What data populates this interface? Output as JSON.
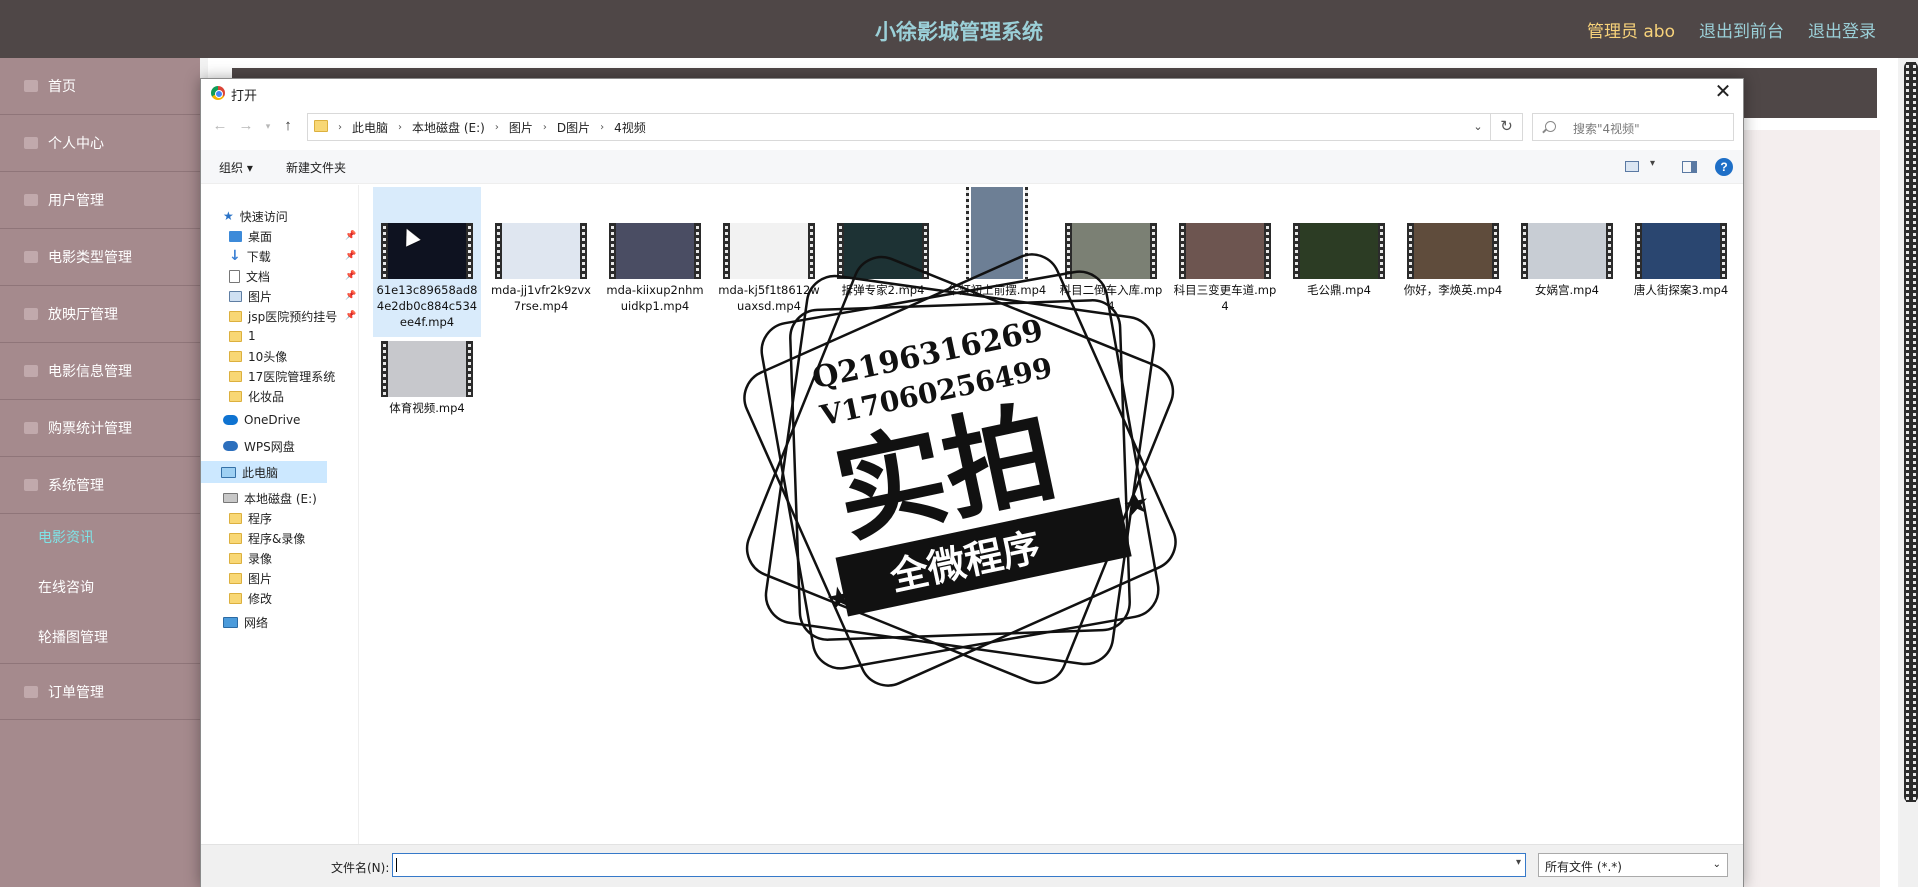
{
  "app": {
    "title": "小徐影城管理系统",
    "nav": [
      {
        "label": "管理员 abo",
        "color": "#f7d27a"
      },
      {
        "label": "退出到前台",
        "color": "#9bd0d8"
      },
      {
        "label": "退出登录",
        "color": "#9bd0d8"
      }
    ]
  },
  "sidebar": {
    "items": [
      {
        "label": "首页"
      },
      {
        "label": "个人中心"
      },
      {
        "label": "用户管理"
      },
      {
        "label": "电影类型管理"
      },
      {
        "label": "放映厅管理"
      },
      {
        "label": "电影信息管理"
      },
      {
        "label": "购票统计管理"
      },
      {
        "label": "系统管理"
      }
    ],
    "sub_items": [
      {
        "label": "电影资讯",
        "active": true
      },
      {
        "label": "在线咨询",
        "active": false
      },
      {
        "label": "轮播图管理",
        "active": false
      }
    ],
    "last_item": {
      "label": "订单管理"
    }
  },
  "dialog": {
    "title": "打开",
    "breadcrumbs": [
      "此电脑",
      "本地磁盘 (E:)",
      "图片",
      "D图片",
      "4视频"
    ],
    "search_placeholder": "搜索\"4视频\"",
    "toolbar": {
      "organize": "组织 ▾",
      "new_folder": "新建文件夹"
    },
    "nav_pane": [
      {
        "label": "快速访问",
        "icon": "star"
      },
      {
        "label": "桌面",
        "icon": "desk",
        "pinned": true
      },
      {
        "label": "下载",
        "icon": "dl",
        "pinned": true
      },
      {
        "label": "文档",
        "icon": "doc",
        "pinned": true
      },
      {
        "label": "图片",
        "icon": "pic",
        "pinned": true
      },
      {
        "label": "jsp医院预约挂号",
        "icon": "folder",
        "pinned": true
      },
      {
        "label": "1",
        "icon": "folder"
      },
      {
        "label": "10头像",
        "icon": "folder"
      },
      {
        "label": "17医院管理系统",
        "icon": "folder"
      },
      {
        "label": "化妆品",
        "icon": "folder"
      },
      {
        "label": "OneDrive",
        "icon": "cloud"
      },
      {
        "label": "WPS网盘",
        "icon": "wps"
      },
      {
        "label": "此电脑",
        "icon": "pc",
        "selected": true
      },
      {
        "label": "本地磁盘 (E:)",
        "icon": "drive"
      },
      {
        "label": "程序",
        "icon": "folder"
      },
      {
        "label": "程序&录像",
        "icon": "folder"
      },
      {
        "label": "录像",
        "icon": "folder"
      },
      {
        "label": "图片",
        "icon": "folder"
      },
      {
        "label": "修改",
        "icon": "folder"
      },
      {
        "label": "网络",
        "icon": "net"
      }
    ],
    "files": [
      {
        "name": "61e13c89658ad84e2db0c884c534ee4f.mp4",
        "thumb": "#0e1220",
        "selected": true
      },
      {
        "name": "mda-jj1vfr2k9zvx7rse.mp4",
        "thumb": "#dfe6f0"
      },
      {
        "name": "mda-kiixup2nhmuidkp1.mp4",
        "thumb": "#4a4d63"
      },
      {
        "name": "mda-kj5f1t8612wuaxsd.mp4",
        "thumb": "#f2f2f2"
      },
      {
        "name": "拆弹专家2.mp4",
        "thumb": "#1d3234"
      },
      {
        "name": "华灯初上前摆.mp4",
        "thumb": "#6d7f95",
        "portrait": true
      },
      {
        "name": "科目二倒车入库.mp4",
        "thumb": "#7b8074"
      },
      {
        "name": "科目三变更车道.mp4",
        "thumb": "#6d5550"
      },
      {
        "name": "毛公鼎.mp4",
        "thumb": "#2c3c24"
      },
      {
        "name": "你好，李焕英.mp4",
        "thumb": "#5f4c3c"
      },
      {
        "name": "女娲宫.mp4",
        "thumb": "#c8cdd4"
      },
      {
        "name": "唐人街探案3.mp4",
        "thumb": "#2a4670"
      },
      {
        "name": "体育视频.mp4",
        "thumb": "#c7c8cc"
      }
    ],
    "filename_label": "文件名(N):",
    "filename_value": "",
    "filetype": "所有文件 (*.*)"
  },
  "watermark": {
    "line1": "Q2196316269",
    "line2": "V17060256499",
    "big": "实拍",
    "banner": "全微程序"
  }
}
